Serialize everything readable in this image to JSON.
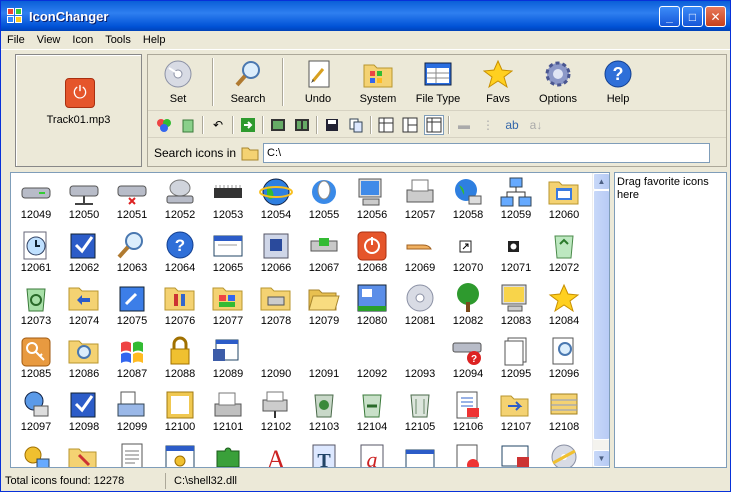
{
  "window": {
    "title": "IconChanger"
  },
  "menu": [
    "File",
    "View",
    "Icon",
    "Tools",
    "Help"
  ],
  "preview": {
    "filename": "Track01.mp3",
    "icon": "power-icon"
  },
  "toolbar": {
    "set": "Set",
    "search": "Search",
    "undo": "Undo",
    "system": "System",
    "file_type": "File Type",
    "favs": "Favs",
    "options": "Options",
    "help": "Help"
  },
  "search": {
    "label": "Search icons in",
    "path": "C:\\"
  },
  "favorites": {
    "hint": "Drag favorite icons here"
  },
  "status": {
    "total": "Total icons found: 12278",
    "file": "C:\\shell32.dll"
  },
  "icons": [
    {
      "num": "12049",
      "icon": "drive-icon"
    },
    {
      "num": "12050",
      "icon": "network-drive-icon"
    },
    {
      "num": "12051",
      "icon": "disconnected-drive-icon"
    },
    {
      "num": "12052",
      "icon": "cd-drive-icon"
    },
    {
      "num": "12053",
      "icon": "memory-chip-icon"
    },
    {
      "num": "12054",
      "icon": "globe-icon"
    },
    {
      "num": "12055",
      "icon": "mouse-globe-icon"
    },
    {
      "num": "12056",
      "icon": "computer-icon"
    },
    {
      "num": "12057",
      "icon": "printer-icon"
    },
    {
      "num": "12058",
      "icon": "network-globe-icon"
    },
    {
      "num": "12059",
      "icon": "network-icon"
    },
    {
      "num": "12060",
      "icon": "program-folder-icon"
    },
    {
      "num": "12061",
      "icon": "clock-document-icon"
    },
    {
      "num": "12062",
      "icon": "checkmark-icon"
    },
    {
      "num": "12063",
      "icon": "search-icon"
    },
    {
      "num": "12064",
      "icon": "help-icon"
    },
    {
      "num": "12065",
      "icon": "window-icon"
    },
    {
      "num": "12066",
      "icon": "shutdown-icon"
    },
    {
      "num": "12067",
      "icon": "dock-icon"
    },
    {
      "num": "12068",
      "icon": "power-icon"
    },
    {
      "num": "12069",
      "icon": "open-hand-icon"
    },
    {
      "num": "12070",
      "icon": "shortcut-arrow-icon"
    },
    {
      "num": "12071",
      "icon": "shortcut-disc-icon"
    },
    {
      "num": "12072",
      "icon": "recycle-bin-icon"
    },
    {
      "num": "12073",
      "icon": "recycle-icon"
    },
    {
      "num": "12074",
      "icon": "share-folder-icon"
    },
    {
      "num": "12075",
      "icon": "update-icon"
    },
    {
      "num": "12076",
      "icon": "control-folder-icon"
    },
    {
      "num": "12077",
      "icon": "app-folder-icon"
    },
    {
      "num": "12078",
      "icon": "printer-folder-icon"
    },
    {
      "num": "12079",
      "icon": "open-folder-icon"
    },
    {
      "num": "12080",
      "icon": "taskbar-icon"
    },
    {
      "num": "12081",
      "icon": "cd-icon"
    },
    {
      "num": "12082",
      "icon": "tree-icon"
    },
    {
      "num": "12083",
      "icon": "desktop-icon"
    },
    {
      "num": "12084",
      "icon": "star-icon"
    },
    {
      "num": "12085",
      "icon": "key-icon"
    },
    {
      "num": "12086",
      "icon": "search-folder-icon"
    },
    {
      "num": "12087",
      "icon": "windows-logo-icon"
    },
    {
      "num": "12088",
      "icon": "lock-icon"
    },
    {
      "num": "12089",
      "icon": "desktop-window-icon"
    },
    {
      "num": "12090",
      "icon": "blank-icon"
    },
    {
      "num": "12091",
      "icon": "blank-icon"
    },
    {
      "num": "12092",
      "icon": "blank-icon"
    },
    {
      "num": "12093",
      "icon": "blank-icon"
    },
    {
      "num": "12094",
      "icon": "drive-help-icon"
    },
    {
      "num": "12095",
      "icon": "pages-icon"
    },
    {
      "num": "12096",
      "icon": "search-document-icon"
    },
    {
      "num": "12097",
      "icon": "network-search-icon"
    },
    {
      "num": "12098",
      "icon": "checkbox-icon"
    },
    {
      "num": "12099",
      "icon": "print-doc-icon"
    },
    {
      "num": "12100",
      "icon": "document-frame-icon"
    },
    {
      "num": "12101",
      "icon": "fax-icon"
    },
    {
      "num": "12102",
      "icon": "network-printer-icon"
    },
    {
      "num": "12103",
      "icon": "trash-full-icon"
    },
    {
      "num": "12104",
      "icon": "trash-recycle-icon"
    },
    {
      "num": "12105",
      "icon": "trash-icon"
    },
    {
      "num": "12106",
      "icon": "doc-restore-icon"
    },
    {
      "num": "12107",
      "icon": "folder-move-icon"
    },
    {
      "num": "12108",
      "icon": "notebook-icon"
    },
    {
      "num": "",
      "icon": "network-settings-icon"
    },
    {
      "num": "",
      "icon": "folder-tools-icon"
    },
    {
      "num": "",
      "icon": "text-document-icon"
    },
    {
      "num": "",
      "icon": "settings-window-icon"
    },
    {
      "num": "",
      "icon": "puzzle-icon"
    },
    {
      "num": "",
      "icon": "font-a-icon"
    },
    {
      "num": "",
      "icon": "font-t-icon"
    },
    {
      "num": "",
      "icon": "font-a-italic-icon"
    },
    {
      "num": "",
      "icon": "window-arrow-icon"
    },
    {
      "num": "",
      "icon": "document-alert-icon"
    },
    {
      "num": "",
      "icon": "network-window-icon"
    },
    {
      "num": "",
      "icon": "cd-burn-icon"
    }
  ]
}
